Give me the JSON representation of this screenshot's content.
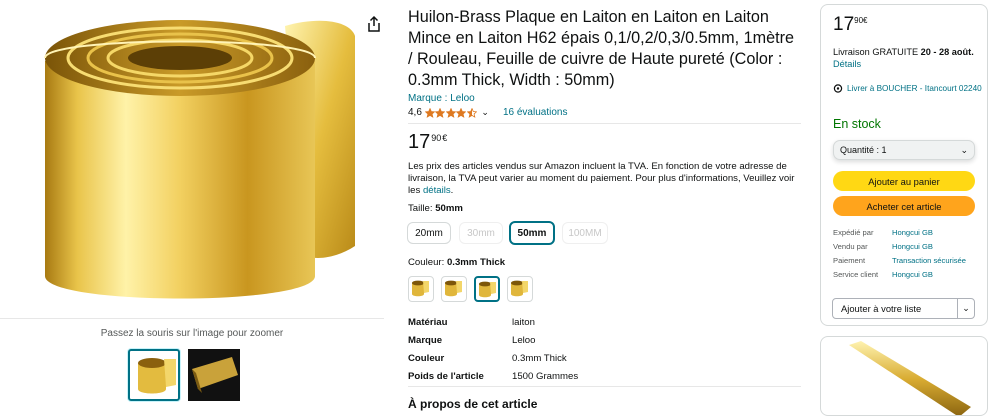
{
  "colors": {
    "link": "#007185",
    "in_stock": "#007600",
    "add_to_cart": "#ffd814",
    "buy_now": "#ffa41c",
    "selected": "#007185",
    "star": "#de7921"
  },
  "gallery": {
    "zoom_hint": "Passez la souris sur l'image pour zoomer"
  },
  "product": {
    "title": "Huilon-Brass Plaque en Laiton en Laiton en Laiton Mince en Laiton H62 épais 0,1/0,2/0,3/0.5mm, 1mètre / Rouleau, Feuille de cuivre de Haute pureté (Color : 0.3mm Thick, Width : 50mm)",
    "brand": "Marque : Leloo",
    "rating_value": "4,6",
    "rating_stars": 4.5,
    "rating_count": "16 évaluations",
    "price_whole": "17",
    "price_fraction": "90",
    "price_currency": "€",
    "vat_text": "Les prix des articles vendus sur Amazon incluent la TVA. En fonction de votre adresse de livraison, la TVA peut varier au moment du paiement. Pour plus d'informations, Veuillez voir les ",
    "vat_link": "détails",
    "vat_end": "."
  },
  "size": {
    "label": "Taille: ",
    "selected": "50mm",
    "options": [
      {
        "label": "20mm",
        "state": "available"
      },
      {
        "label": "30mm",
        "state": "unavailable"
      },
      {
        "label": "50mm",
        "state": "selected"
      },
      {
        "label": "100MM",
        "state": "unavailable"
      }
    ]
  },
  "color": {
    "label": "Couleur: ",
    "selected": "0.3mm Thick",
    "selected_index": 3
  },
  "specs": [
    {
      "key": "Matériau",
      "value": "laiton"
    },
    {
      "key": "Marque",
      "value": "Leloo"
    },
    {
      "key": "Couleur",
      "value": "0.3mm Thick"
    },
    {
      "key": "Poids de l'article",
      "value": "1500 Grammes"
    }
  ],
  "about_heading": "À propos de cet article",
  "buybox": {
    "price_whole": "17",
    "price_fraction": "90",
    "price_currency": "€",
    "delivery_prefix": "Livraison GRATUITE ",
    "delivery_dates": "20 - 28 août",
    "delivery_dot": ". ",
    "delivery_link": "Détails",
    "deliver_to": "Livrer à BOUCHER - Itancourt 02240",
    "stock": "En stock",
    "quantity": "Quantité : 1",
    "add_to_cart": "Ajouter au panier",
    "buy_now": "Acheter cet article",
    "seller_rows": [
      {
        "key": "Expédié par",
        "value": "Hongcui GB"
      },
      {
        "key": "Vendu par",
        "value": "Hongcui GB"
      },
      {
        "key": "Paiement",
        "value": "Transaction sécurisée"
      },
      {
        "key": "Service client",
        "value": "Hongcui GB"
      }
    ],
    "wishlist": "Ajouter à votre liste"
  },
  "icons": [
    "share-icon",
    "location-pin-icon",
    "chevron-down-icon",
    "star-icon"
  ]
}
